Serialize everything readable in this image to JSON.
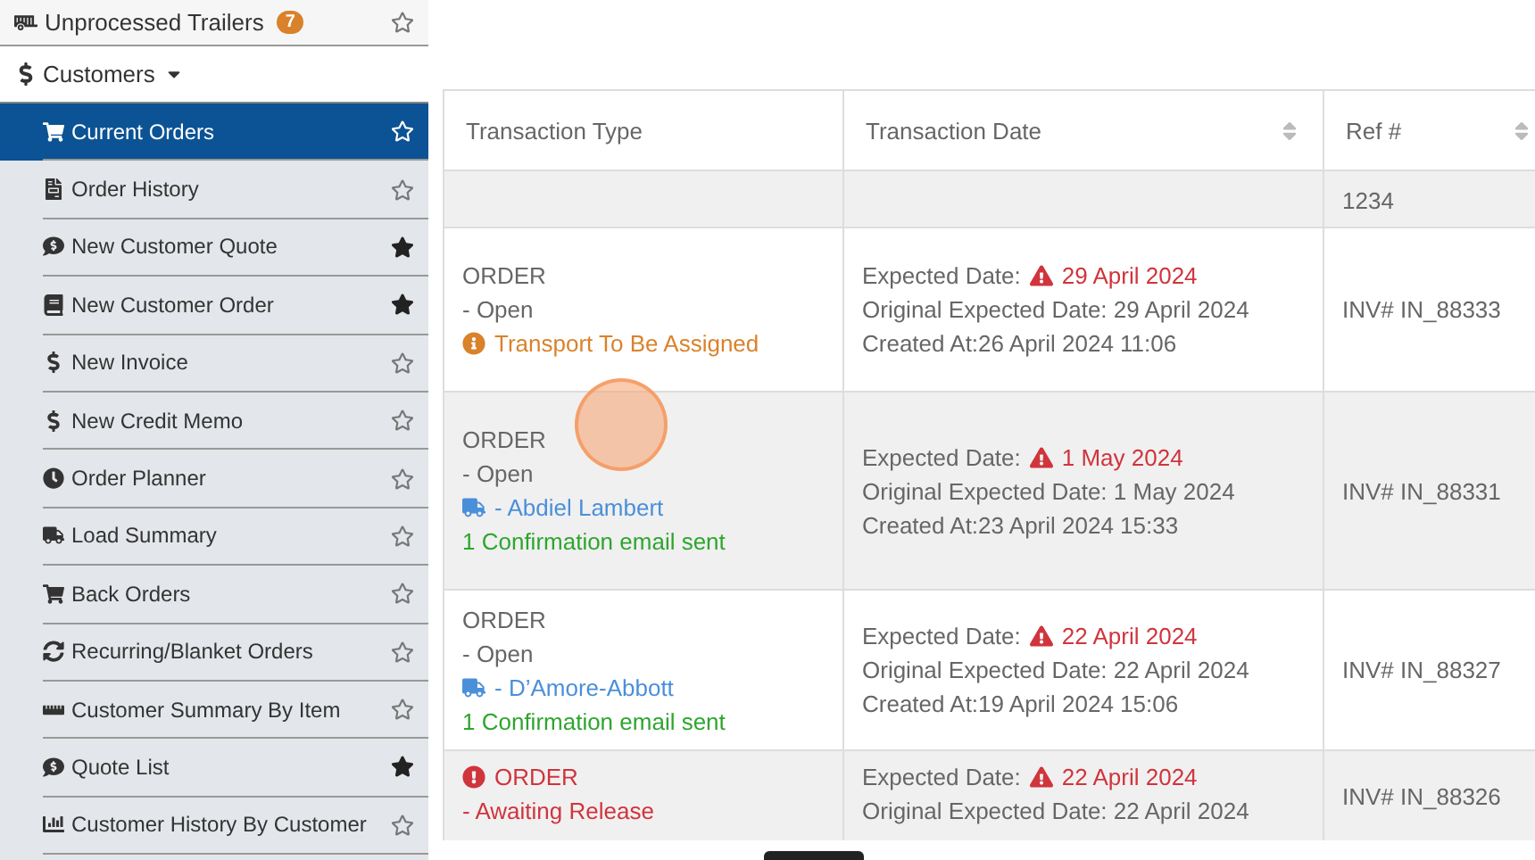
{
  "sidebar": {
    "top_item": {
      "label": "Unprocessed Trailers",
      "badge": "7",
      "favorite": false
    },
    "section": {
      "label": "Customers",
      "expanded": true
    },
    "items": [
      {
        "label": "Current Orders",
        "selected": true,
        "favorite": false
      },
      {
        "label": "Order History",
        "selected": false,
        "favorite": false
      },
      {
        "label": "New Customer Quote",
        "selected": false,
        "favorite": true
      },
      {
        "label": "New Customer Order",
        "selected": false,
        "favorite": true
      },
      {
        "label": "New Invoice",
        "selected": false,
        "favorite": false
      },
      {
        "label": "New Credit Memo",
        "selected": false,
        "favorite": false
      },
      {
        "label": "Order Planner",
        "selected": false,
        "favorite": false
      },
      {
        "label": "Load Summary",
        "selected": false,
        "favorite": false
      },
      {
        "label": "Back Orders",
        "selected": false,
        "favorite": false
      },
      {
        "label": "Recurring/Blanket Orders",
        "selected": false,
        "favorite": false
      },
      {
        "label": "Customer Summary By Item",
        "selected": false,
        "favorite": false
      },
      {
        "label": "Quote List",
        "selected": false,
        "favorite": true
      },
      {
        "label": "Customer History By Customer",
        "selected": false,
        "favorite": false
      }
    ]
  },
  "table": {
    "columns": [
      {
        "label": "Transaction Type",
        "sortable": false
      },
      {
        "label": "Transaction Date",
        "sortable": true
      },
      {
        "label": "Ref #",
        "sortable": true
      }
    ],
    "partial_row": {
      "ref": "1234"
    },
    "rows": [
      {
        "type": "ORDER",
        "status": "- Open",
        "alert": false,
        "transport": {
          "kind": "unassigned",
          "text": "Transport To Be Assigned"
        },
        "expected_label": "Expected Date:",
        "expected_date": "29 April 2024",
        "original": "Original Expected Date: 29 April 2024",
        "created": "Created At:26 April 2024 11:06",
        "ref": "INV# IN_88333"
      },
      {
        "type": "ORDER",
        "status": "- Open",
        "alert": false,
        "transport": {
          "kind": "carrier",
          "text": "- Abdiel Lambert"
        },
        "email": "1 Confirmation email sent",
        "expected_label": "Expected Date:",
        "expected_date": "1 May 2024",
        "original": "Original Expected Date: 1 May 2024",
        "created": "Created At:23 April 2024 15:33",
        "ref": "INV# IN_88331"
      },
      {
        "type": "ORDER",
        "status": "- Open",
        "alert": false,
        "transport": {
          "kind": "carrier",
          "text": "- D’Amore-Abbott"
        },
        "email": "1 Confirmation email sent",
        "expected_label": "Expected Date:",
        "expected_date": "22 April 2024",
        "original": "Original Expected Date: 22 April 2024",
        "created": "Created At:19 April 2024 15:06",
        "ref": "INV# IN_88327"
      },
      {
        "type": "ORDER",
        "status": "- Awaiting Release",
        "alert": true,
        "expected_label": "Expected Date:",
        "expected_date": "22 April 2024",
        "original": "Original Expected Date: 22 April 2024",
        "ref": "INV# IN_88326"
      }
    ]
  }
}
